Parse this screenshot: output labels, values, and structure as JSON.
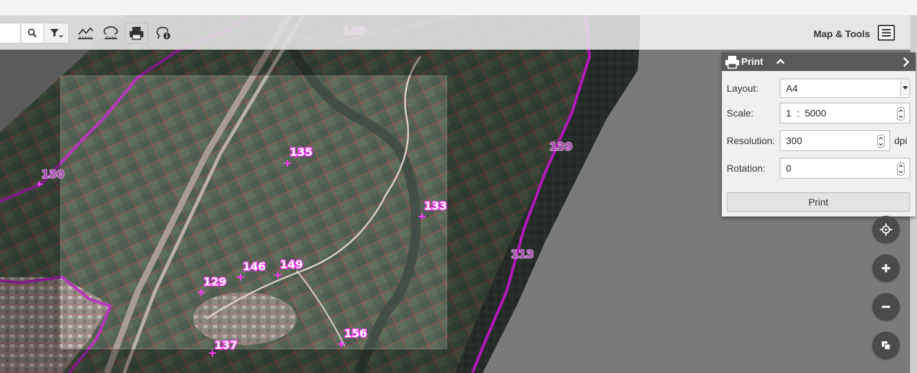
{
  "toolbar": {
    "search_placeholder": "",
    "map_tools_label": "Map & Tools"
  },
  "print_panel": {
    "title": "Print",
    "layout_label": "Layout:",
    "layout_value": "A4",
    "scale_label": "Scale:",
    "scale_value": "1  :  5000",
    "resolution_label": "Resolution:",
    "resolution_value": "300",
    "resolution_unit": "dpi",
    "rotation_label": "Rotation:",
    "rotation_value": "0",
    "print_button_label": "Print"
  },
  "map": {
    "parcel_labels": [
      "135",
      "133",
      "146",
      "149",
      "129",
      "137",
      "156"
    ],
    "zone_labels": [
      "130",
      "140",
      "139",
      "113"
    ]
  },
  "colors": {
    "panel_header": "#5a5a5a",
    "map_control": "#4b4b4b",
    "boundary": "#b01ab8",
    "parcel_line": "#e02828",
    "label_pink": "#ff66ff"
  },
  "icons": {
    "search": "search-icon",
    "filter": "filter-icon",
    "profile": "elevation-profile-icon",
    "measure": "measure-icon",
    "print": "printer-icon",
    "info": "info-query-icon",
    "menu": "hamburger-menu-icon",
    "locate": "locate-crosshair-icon",
    "zoom_in": "plus-icon",
    "zoom_out": "minus-icon",
    "layers": "layers-icon"
  }
}
